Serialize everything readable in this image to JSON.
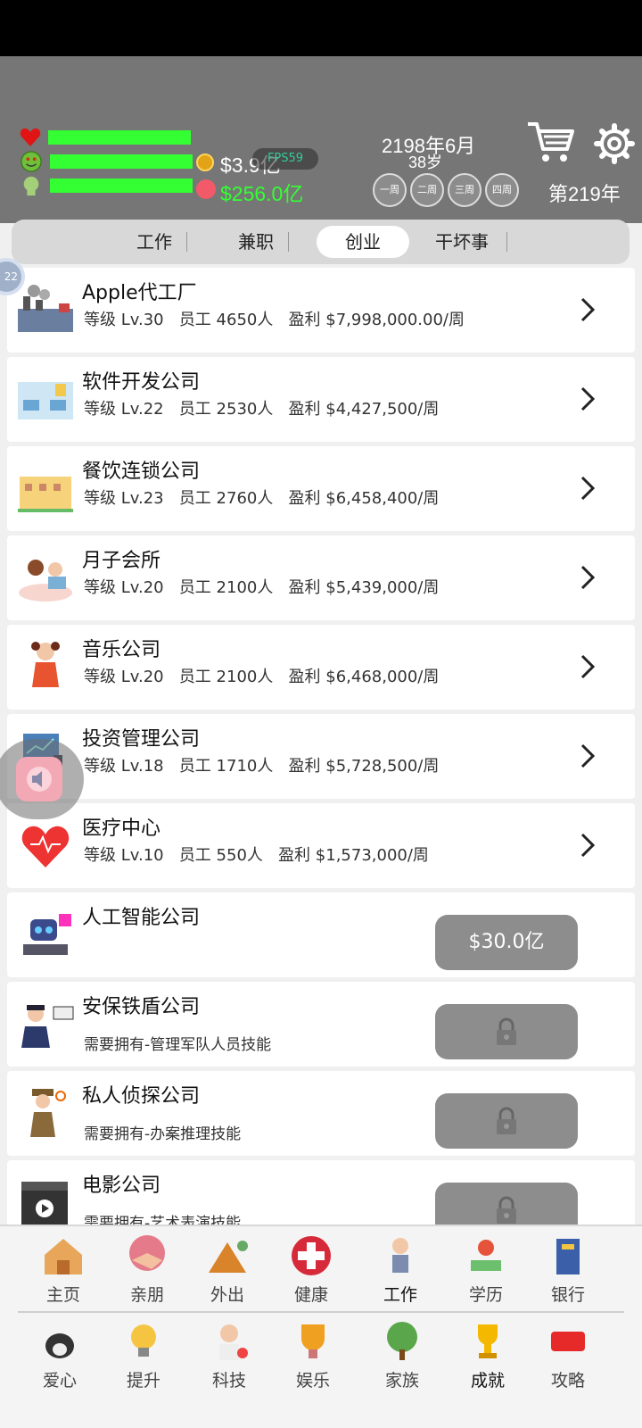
{
  "header": {
    "money": "$3.9亿",
    "fps": "FPS59",
    "savings": "$256.0亿",
    "date": "2198年6月",
    "age": "38岁",
    "weeks": [
      "一周",
      "二周",
      "三周",
      "四周"
    ],
    "year": "第219年",
    "colors": {
      "bar": "#33ff33",
      "header_bg": "#767676"
    }
  },
  "tabs": [
    "工作",
    "兼职",
    "创业",
    "干坏事"
  ],
  "active_tab": "创业",
  "float_badge": "22",
  "businesses": [
    {
      "name": "Apple代工厂",
      "level": "等级 Lv.30",
      "staff": "员工 4650人",
      "profit": "盈利 $7,998,000.00/周"
    },
    {
      "name": "软件开发公司",
      "level": "等级 Lv.22",
      "staff": "员工 2530人",
      "profit": "盈利 $4,427,500/周"
    },
    {
      "name": "餐饮连锁公司",
      "level": "等级 Lv.23",
      "staff": "员工 2760人",
      "profit": "盈利 $6,458,400/周"
    },
    {
      "name": "月子会所",
      "level": "等级 Lv.20",
      "staff": "员工 2100人",
      "profit": "盈利 $5,439,000/周"
    },
    {
      "name": "音乐公司",
      "level": "等级 Lv.20",
      "staff": "员工 2100人",
      "profit": "盈利 $6,468,000/周"
    },
    {
      "name": "投资管理公司",
      "level": "等级 Lv.18",
      "staff": "员工 1710人",
      "profit": "盈利 $5,728,500/周"
    },
    {
      "name": "医疗中心",
      "level": "等级 Lv.10",
      "staff": "员工 550人",
      "profit": "盈利 $1,573,000/周"
    }
  ],
  "purchasable": {
    "name": "人工智能公司",
    "price": "$30.0亿"
  },
  "locked": [
    {
      "name": "安保铁盾公司",
      "requirement": "需要拥有-管理军队人员技能"
    },
    {
      "name": "私人侦探公司",
      "requirement": "需要拥有-办案推理技能"
    },
    {
      "name": "电影公司",
      "requirement": "需要拥有-艺术表演技能"
    }
  ],
  "nav_row1": [
    "主页",
    "亲朋",
    "外出",
    "健康",
    "工作",
    "学历",
    "银行"
  ],
  "nav_row2": [
    "爱心",
    "提升",
    "科技",
    "娱乐",
    "家族",
    "成就",
    "攻略"
  ]
}
